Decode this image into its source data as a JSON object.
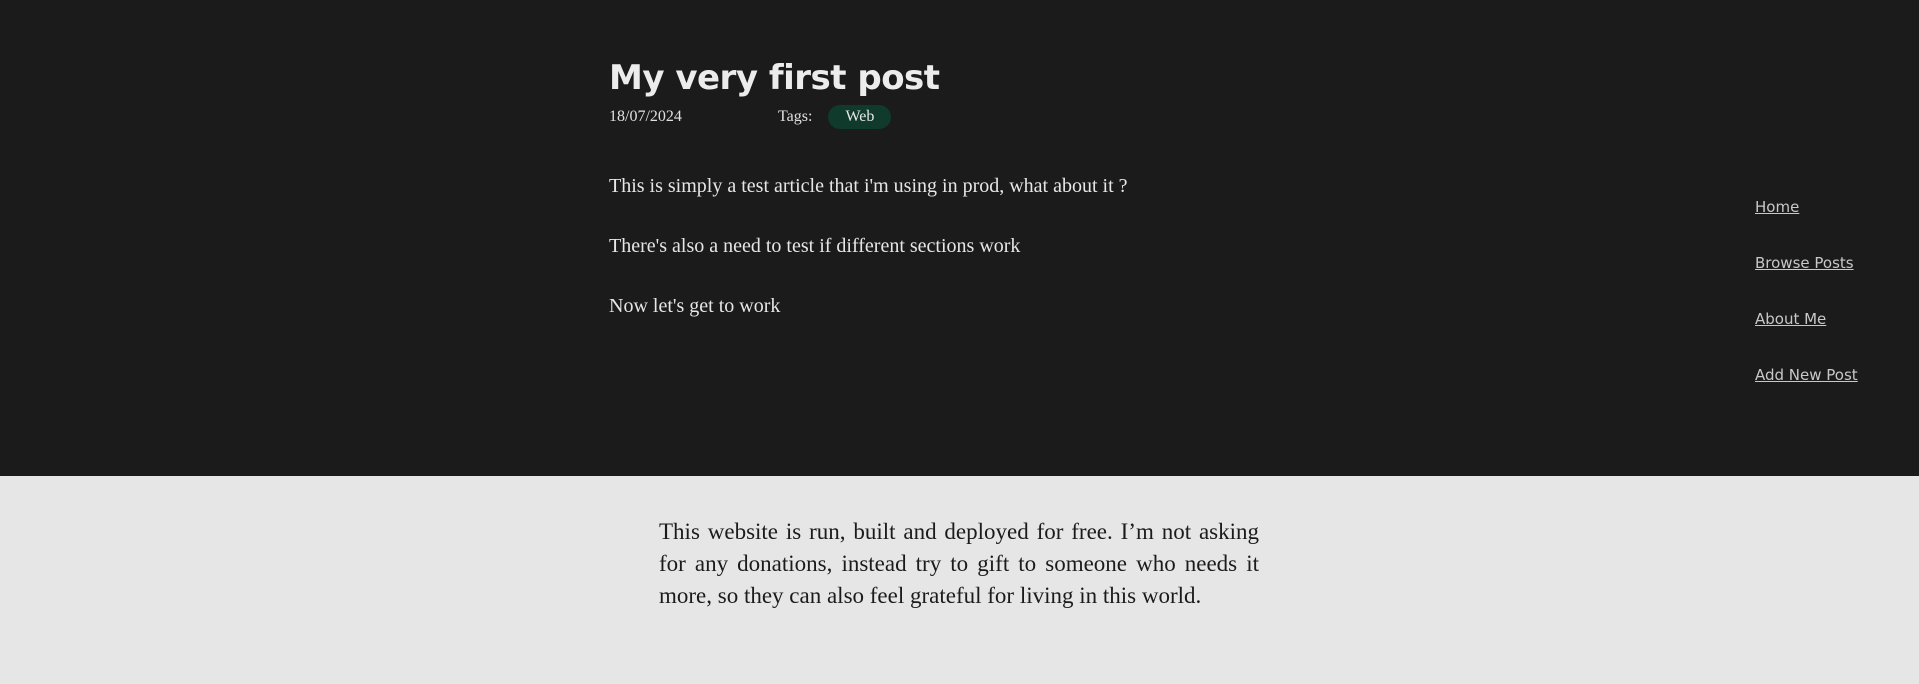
{
  "post": {
    "title": "My very first post",
    "date": "18/07/2024",
    "tags_label": "Tags:",
    "tags": [
      "Web"
    ],
    "paragraphs": [
      "This is simply a test article that i'm using in prod, what about it ?",
      "There's also a need to test if different sections work",
      "Now let's get to work"
    ]
  },
  "nav": {
    "items": [
      {
        "label": "Home"
      },
      {
        "label": "Browse Posts"
      },
      {
        "label": "About Me"
      },
      {
        "label": "Add New Post"
      }
    ]
  },
  "footer": {
    "text": "This website is run, built and deployed for free. I’m not asking for any donations, instead try to gift to someone who needs it more, so they can also feel grateful for living in this world."
  },
  "colors": {
    "background": "#1b1b1b",
    "tag_background": "#0f3a2c",
    "footer_background": "#e6e6e6"
  }
}
